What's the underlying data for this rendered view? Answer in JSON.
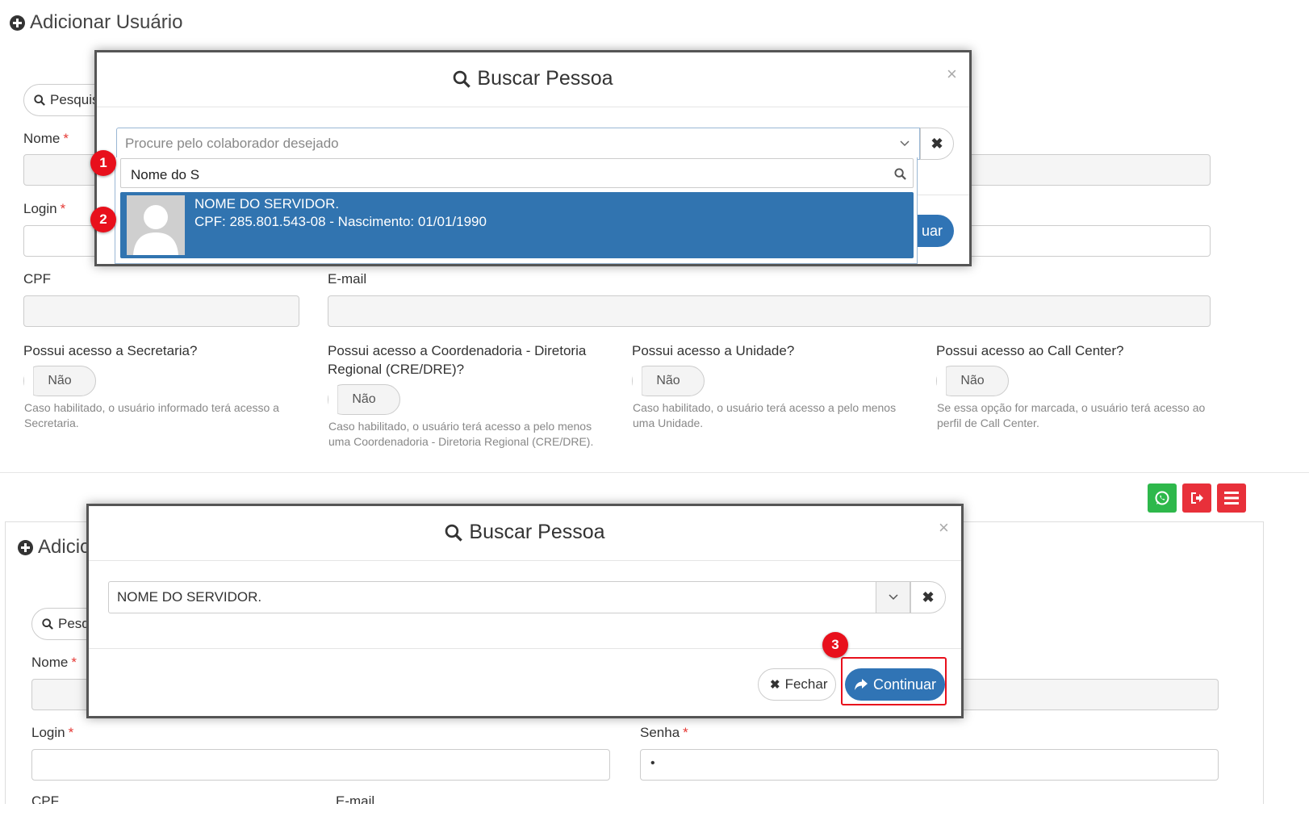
{
  "top": {
    "page_title": "Adicionar Usuário",
    "search_button": "Pesquis",
    "fields": {
      "nome_label": "Nome",
      "login_label": "Login",
      "cpf_label": "CPF",
      "email_label": "E-mail",
      "required_mark": "*"
    },
    "access": [
      {
        "question": "Possui acesso a Secretaria?",
        "toggle": "Não",
        "help": "Caso habilitado, o usuário informado terá acesso a Secretaria."
      },
      {
        "question": "Possui acesso a Coordenadoria - Diretoria Regional (CRE/DRE)?",
        "toggle": "Não",
        "help": "Caso habilitado, o usuário terá acesso a pelo menos uma Coordenadoria - Diretoria Regional (CRE/DRE)."
      },
      {
        "question": "Possui acesso a Unidade?",
        "toggle": "Não",
        "help": "Caso habilitado, o usuário terá acesso a pelo menos uma Unidade."
      },
      {
        "question": "Possui acesso ao Call Center?",
        "toggle": "Não",
        "help": "Se essa opção for marcada, o usuário terá acesso ao perfil de Call Center."
      }
    ],
    "modal": {
      "title": "Buscar Pessoa",
      "close": "×",
      "select_placeholder": "Procure pelo colaborador desejado",
      "search_value": "Nome do S",
      "result": {
        "name": "NOME DO SERVIDOR.",
        "details": "CPF: 285.801.543-08 - Nascimento: 01/01/1990"
      },
      "partial_button": "uar"
    },
    "markers": [
      "1",
      "2"
    ]
  },
  "bottom": {
    "page_title": "Adicio",
    "search_button": "Pesq",
    "fields": {
      "nome_label": "Nome",
      "login_label": "Login",
      "senha_label": "Senha",
      "senha_value": "•",
      "cpf_label": "CPF",
      "email_label": "E-mail",
      "required_mark": "*"
    },
    "modal": {
      "title": "Buscar Pessoa",
      "close": "×",
      "selected_value": "NOME DO SERVIDOR.",
      "fechar_label": "Fechar",
      "continuar_label": "Continuar"
    },
    "marker": "3",
    "header_buttons": [
      "whatsapp-icon",
      "logout-icon",
      "menu-icon"
    ],
    "colors": {
      "whatsapp": "#2eb84b",
      "logout": "#e8303a",
      "menu": "#e8303a",
      "primary": "#3074b5",
      "highlight": "#e8101c"
    }
  }
}
